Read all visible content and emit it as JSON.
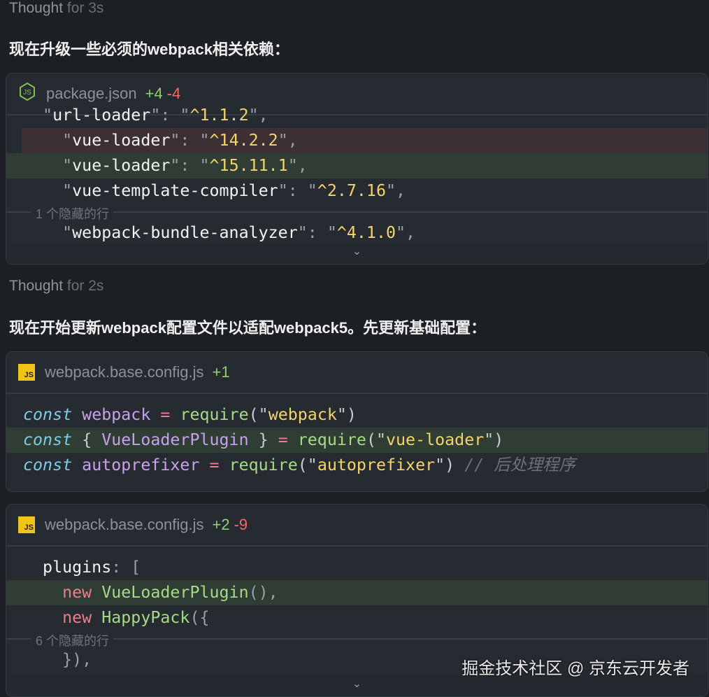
{
  "thoughts": [
    {
      "label": "Thought",
      "duration": "for 3s"
    },
    {
      "label": "Thought",
      "duration": "for 2s"
    }
  ],
  "messages": [
    "现在升级一些必须的webpack相关依赖：",
    "现在开始更新webpack配置文件以适配webpack5。先更新基础配置："
  ],
  "cards": [
    {
      "icon": "nodejs-icon",
      "file": "package.json",
      "added": "+4",
      "removed": "-4",
      "lines": [
        {
          "type": "partial",
          "tokens": [
            [
              "q",
              "  \""
            ],
            [
              "w",
              "url-loader"
            ],
            [
              "q",
              "\": \""
            ],
            [
              "s",
              "^1.1.2"
            ],
            [
              "q",
              "\","
            ]
          ]
        },
        {
          "type": "removed",
          "tokens": [
            [
              "q",
              "    \""
            ],
            [
              "w",
              "vue-loader"
            ],
            [
              "q",
              "\": \""
            ],
            [
              "s",
              "^14.2.2"
            ],
            [
              "q",
              "\","
            ]
          ]
        },
        {
          "type": "added",
          "tokens": [
            [
              "q",
              "    \""
            ],
            [
              "w",
              "vue-loader"
            ],
            [
              "q",
              "\": \""
            ],
            [
              "s",
              "^15.11.1"
            ],
            [
              "q",
              "\","
            ]
          ]
        },
        {
          "type": "normal",
          "tokens": [
            [
              "q",
              "    \""
            ],
            [
              "w",
              "vue-template-compiler"
            ],
            [
              "q",
              "\": \""
            ],
            [
              "s",
              "^2.7.16"
            ],
            [
              "q",
              "\","
            ]
          ]
        },
        {
          "type": "hidden",
          "text": "1 个隐藏的行"
        },
        {
          "type": "normal",
          "tokens": [
            [
              "q",
              "    \""
            ],
            [
              "w",
              "webpack-bundle-analyzer"
            ],
            [
              "q",
              "\": \""
            ],
            [
              "s",
              "^4.1.0"
            ],
            [
              "q",
              "\","
            ]
          ]
        }
      ],
      "expand": "⌄"
    },
    {
      "icon": "js-icon",
      "iconText": "JS",
      "file": "webpack.base.config.js",
      "added": "+1",
      "removed": "",
      "lines": [
        {
          "type": "normal",
          "tokens": [
            [
              "k",
              "const"
            ],
            [
              "p",
              " "
            ],
            [
              "v",
              "webpack"
            ],
            [
              "p",
              " "
            ],
            [
              "o",
              "="
            ],
            [
              "p",
              " "
            ],
            [
              "f",
              "require"
            ],
            [
              "p",
              "(\""
            ],
            [
              "s",
              "webpack"
            ],
            [
              "p",
              "\")"
            ]
          ]
        },
        {
          "type": "added",
          "tokens": [
            [
              "k",
              "const"
            ],
            [
              "p",
              " { "
            ],
            [
              "v",
              "VueLoaderPlugin"
            ],
            [
              "p",
              " } "
            ],
            [
              "o",
              "="
            ],
            [
              "p",
              " "
            ],
            [
              "f",
              "require"
            ],
            [
              "p",
              "(\""
            ],
            [
              "s",
              "vue-loader"
            ],
            [
              "p",
              "\")"
            ]
          ]
        },
        {
          "type": "normal",
          "tokens": [
            [
              "k",
              "const"
            ],
            [
              "p",
              " "
            ],
            [
              "v",
              "autoprefixer"
            ],
            [
              "p",
              " "
            ],
            [
              "o",
              "="
            ],
            [
              "p",
              " "
            ],
            [
              "f",
              "require"
            ],
            [
              "p",
              "(\""
            ],
            [
              "s",
              "autoprefixer"
            ],
            [
              "p",
              "\") "
            ],
            [
              "c",
              "// 后处理程序"
            ]
          ]
        }
      ]
    },
    {
      "icon": "js-icon",
      "iconText": "JS",
      "file": "webpack.base.config.js",
      "added": "+2",
      "removed": "-9",
      "lines": [
        {
          "type": "normal",
          "tokens": [
            [
              "w",
              "  plugins"
            ],
            [
              "q",
              ": ["
            ]
          ]
        },
        {
          "type": "added",
          "tokens": [
            [
              "n",
              "    new"
            ],
            [
              "p",
              " "
            ],
            [
              "f",
              "VueLoaderPlugin"
            ],
            [
              "q",
              "(),"
            ]
          ]
        },
        {
          "type": "normal",
          "tokens": [
            [
              "n",
              "    new"
            ],
            [
              "p",
              " "
            ],
            [
              "f",
              "HappyPack"
            ],
            [
              "q",
              "({"
            ]
          ]
        },
        {
          "type": "hidden",
          "text": "6 个隐藏的行"
        },
        {
          "type": "normal",
          "tokens": [
            [
              "q",
              "    }),"
            ]
          ]
        }
      ],
      "expand": "⌄"
    }
  ],
  "watermark": "掘金技术社区 @ 京东云开发者"
}
